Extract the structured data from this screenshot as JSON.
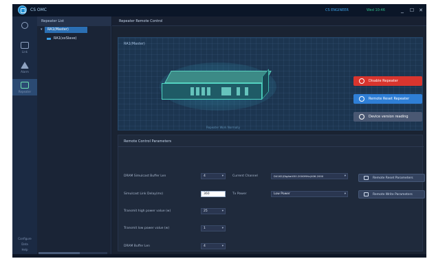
{
  "app": {
    "title": "CS OMC",
    "user": "CS ENGINEER",
    "time": "Wed 10:46",
    "minimize": "_",
    "maximize": "☐",
    "close": "✕"
  },
  "rail": {
    "items": [
      {
        "label": ""
      },
      {
        "label": "Link"
      },
      {
        "label": "Alarm"
      },
      {
        "label": "Repeater"
      }
    ],
    "bottom": [
      "Configure",
      "Data",
      "Help"
    ]
  },
  "tree": {
    "header": "Repeater List",
    "nodes": [
      {
        "label": "RA1(Master)",
        "selected": true
      },
      {
        "label": "RA1(xxSlave)",
        "selected": false
      }
    ]
  },
  "main": {
    "header": "Repeater Remote Control",
    "device_panel": {
      "label": "RA1(Master)",
      "footnote": "Repeater Work Normally",
      "buttons": {
        "disable": "Disable Repeater",
        "reset": "Remote Reset Repeater",
        "reading": "Device version reading"
      }
    },
    "params": {
      "title": "Remote Control Parameters",
      "dram_simulcast_label": "DRAM Simulcast Buffer Len",
      "dram_simulcast_value": "4",
      "current_channel_label": "Current Channel",
      "current_channel_value": "D4162(Digital450.2000MHz)406.2000",
      "simulcast_delay_label": "Simulcast Link Delay(ms)",
      "simulcast_delay_value": "360",
      "tx_power_label": "Tx Power",
      "tx_power_value": "Low Power",
      "high_power_label": "Transmit high power value (w)",
      "high_power_value": "25",
      "low_power_label": "Transmit low power value (w)",
      "low_power_value": "1",
      "dram_buffer_label": "DRAM Buffer Len",
      "dram_buffer_value": "4",
      "reset_params_button": "Remote Reset Parameters",
      "write_params_button": "Remote Write Parameters"
    }
  },
  "colors": {
    "disable_button": "#d9352e",
    "reset_button": "#2f7fd6",
    "reading_button": "#4a5873",
    "accent": "#2b6fb3"
  },
  "icons": {
    "logo": "globe-logo-icon",
    "disable": "prohibit-icon",
    "reset": "reset-icon",
    "reading": "disk-icon",
    "reset_params": "camera-icon",
    "write_params": "edit-icon"
  }
}
